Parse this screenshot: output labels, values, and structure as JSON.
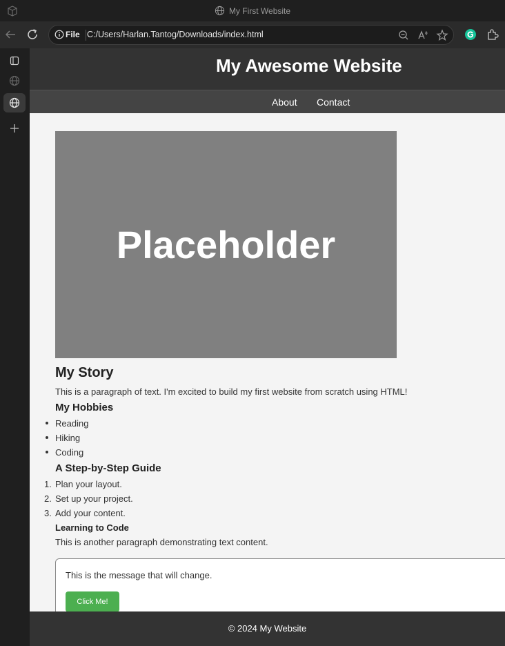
{
  "browser": {
    "tab_title": "My First Website",
    "address_scheme_chip": "File",
    "url": "C:/Users/Harlan.Tantog/Downloads/index.html",
    "icons": [
      "collections-icon",
      "globe-icon",
      "back-icon",
      "refresh-icon",
      "info-icon",
      "zoom-out-icon",
      "read-aloud-icon",
      "favorite-star-icon",
      "grammarly-icon",
      "extensions-icon"
    ],
    "sidebar_icons": [
      "tab-actions-icon",
      "globe-icon",
      "globe-icon",
      "new-tab-plus-icon"
    ]
  },
  "site": {
    "title": "My Awesome Website",
    "nav": {
      "about": "About",
      "contact": "Contact"
    },
    "placeholder_label": "Placeholder",
    "story_heading": "My Story",
    "story_paragraph": "This is a paragraph of text. I'm excited to build my first website from scratch using HTML!",
    "hobbies_heading": "My Hobbies",
    "hobbies": [
      "Reading",
      "Hiking",
      "Coding"
    ],
    "guide_heading": "A Step-by-Step Guide",
    "guide_steps": [
      "Plan your layout.",
      "Set up your project.",
      "Add your content."
    ],
    "guide_numbers": [
      "1.",
      "2.",
      "3."
    ],
    "learning_heading": "Learning to Code",
    "learning_paragraph": "This is another paragraph demonstrating text content.",
    "message": "This is the message that will change.",
    "button_label": "Click Me!",
    "footer": "© 2024 My Website"
  },
  "colors": {
    "header_bg": "#333333",
    "nav_bg": "#444444",
    "placeholder_bg": "#808080",
    "button_green": "#4caf50",
    "page_bg": "#f4f4f4"
  }
}
